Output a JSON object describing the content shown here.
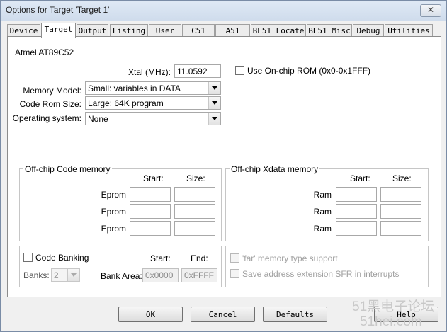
{
  "window": {
    "title": "Options for Target 'Target 1'",
    "close_label": "✕"
  },
  "tabs": [
    {
      "label": "Device"
    },
    {
      "label": "Target",
      "active": true
    },
    {
      "label": "Output"
    },
    {
      "label": "Listing"
    },
    {
      "label": "User"
    },
    {
      "label": "C51"
    },
    {
      "label": "A51"
    },
    {
      "label": "BL51 Locate"
    },
    {
      "label": "BL51 Misc"
    },
    {
      "label": "Debug"
    },
    {
      "label": "Utilities"
    }
  ],
  "device": "Atmel AT89C52",
  "xtal": {
    "label": "Xtal (MHz):",
    "value": "11.0592"
  },
  "onchip_rom": {
    "label": "Use On-chip ROM (0x0-0x1FFF)",
    "checked": false
  },
  "memory_model": {
    "label": "Memory Model:",
    "value": "Small: variables in DATA"
  },
  "code_rom_size": {
    "label": "Code Rom Size:",
    "value": "Large: 64K program"
  },
  "operating_system": {
    "label": "Operating system:",
    "value": "None"
  },
  "offchip_code": {
    "title": "Off-chip Code memory",
    "start_header": "Start:",
    "size_header": "Size:",
    "rows": [
      {
        "label": "Eprom"
      },
      {
        "label": "Eprom"
      },
      {
        "label": "Eprom"
      }
    ]
  },
  "offchip_xdata": {
    "title": "Off-chip Xdata memory",
    "start_header": "Start:",
    "size_header": "Size:",
    "rows": [
      {
        "label": "Ram"
      },
      {
        "label": "Ram"
      },
      {
        "label": "Ram"
      }
    ]
  },
  "code_banking": {
    "label": "Code Banking",
    "checked": false,
    "start_header": "Start:",
    "end_header": "End:",
    "banks_label": "Banks:",
    "banks_value": "2",
    "bank_area_label": "Bank Area:",
    "bank_area_start": "0x0000",
    "bank_area_end": "0xFFFF"
  },
  "far_memory": {
    "label": "'far' memory type support",
    "checked": false
  },
  "save_sfr": {
    "label": "Save address extension SFR in interrupts",
    "checked": false
  },
  "buttons": {
    "ok": "OK",
    "cancel": "Cancel",
    "defaults": "Defaults",
    "help": "Help"
  },
  "watermark": {
    "line1": "51黑电子论坛",
    "line2": "51hei.com"
  }
}
